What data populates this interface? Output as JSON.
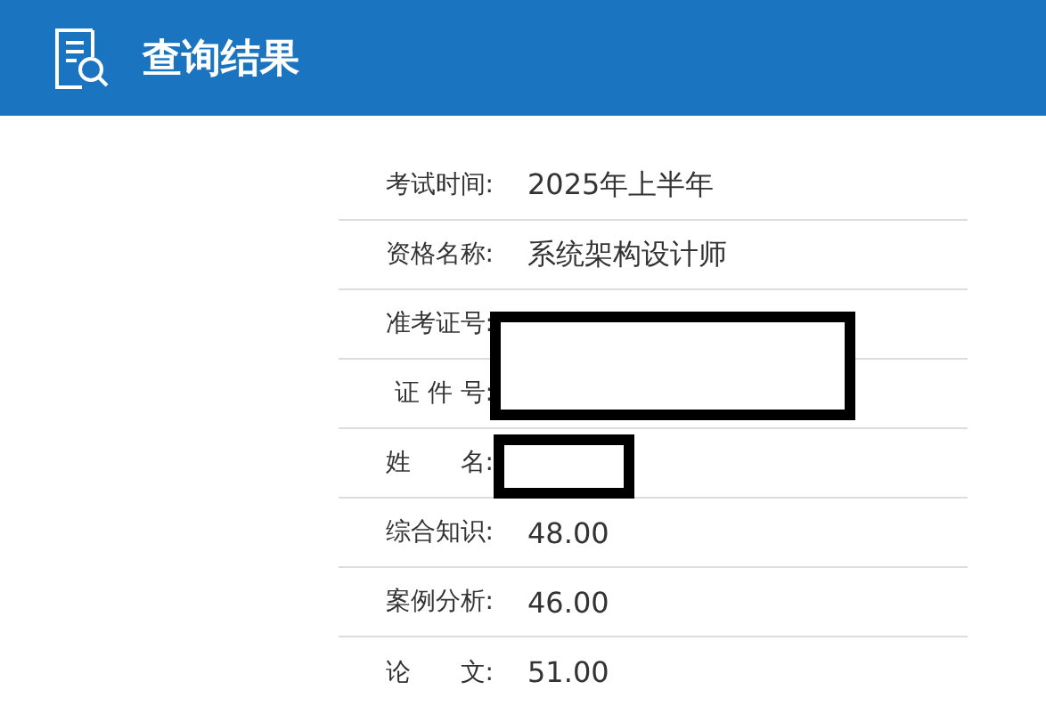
{
  "header": {
    "title": "查询结果"
  },
  "rows": [
    {
      "label": "考试时间:",
      "value": "2025年上半年",
      "redacted": false
    },
    {
      "label": "资格名称:",
      "value": "系统架构设计师",
      "redacted": false
    },
    {
      "label": "准考证号:",
      "redacted": true
    },
    {
      "label": "证 件 号:",
      "redacted": true
    },
    {
      "label": "姓　　名:",
      "redacted": true
    },
    {
      "label": "综合知识:",
      "value": "48.00",
      "redacted": false
    },
    {
      "label": "案例分析:",
      "value": "46.00",
      "redacted": false
    },
    {
      "label": "论　　文:",
      "value": "51.00",
      "redacted": false
    }
  ]
}
